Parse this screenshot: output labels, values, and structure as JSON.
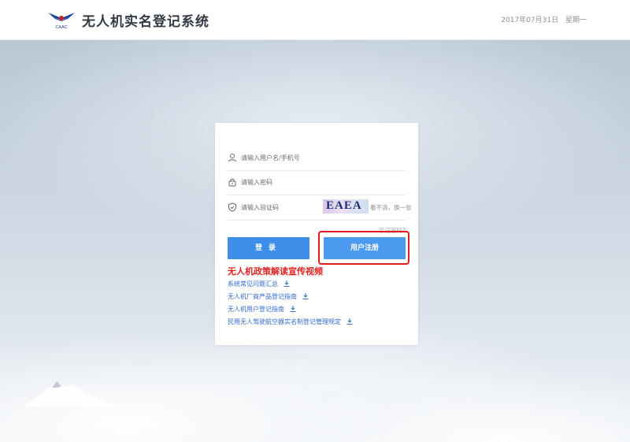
{
  "header": {
    "logo_text": "CAAC",
    "title": "无人机实名登记系统",
    "date": "2017年07月31日",
    "weekday": "星期一"
  },
  "login": {
    "username_placeholder": "请输入用户名/手机号",
    "password_placeholder": "请输入密码",
    "captcha_placeholder": "请输入验证码",
    "captcha_code": "EAEA",
    "captcha_refresh": "看不清，换一张",
    "forgot_password": "忘记密码?",
    "login_button": "登录",
    "register_button": "用户注册"
  },
  "links": {
    "video": "无人机政策解读宣传视频",
    "items": [
      "系统常见问题汇总",
      "无人机厂商产品登记指南",
      "无人机用户登记指南",
      "民用无人驾驶航空器实名制登记管理规定"
    ]
  },
  "colors": {
    "primary_button": "#3d8ee8",
    "link": "#2f6ad0",
    "highlight": "#e11d1d"
  },
  "icons": {
    "username": "user-icon",
    "password": "lock-icon",
    "captcha": "shield-icon",
    "download": "download-icon"
  }
}
